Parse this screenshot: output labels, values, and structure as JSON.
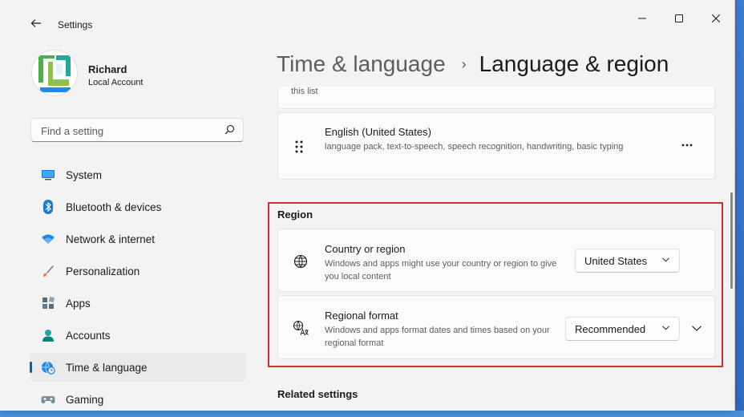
{
  "window": {
    "title": "Settings"
  },
  "profile": {
    "name": "Richard",
    "account_type": "Local Account"
  },
  "search": {
    "placeholder": "Find a setting"
  },
  "sidebar": {
    "items": [
      {
        "label": "System",
        "icon": "monitor-icon",
        "active": false
      },
      {
        "label": "Bluetooth & devices",
        "icon": "bluetooth-icon",
        "active": false
      },
      {
        "label": "Network & internet",
        "icon": "wifi-icon",
        "active": false
      },
      {
        "label": "Personalization",
        "icon": "brush-icon",
        "active": false
      },
      {
        "label": "Apps",
        "icon": "apps-icon",
        "active": false
      },
      {
        "label": "Accounts",
        "icon": "person-icon",
        "active": false
      },
      {
        "label": "Time & language",
        "icon": "globe-clock-icon",
        "active": true
      },
      {
        "label": "Gaming",
        "icon": "gamepad-icon",
        "active": false
      }
    ]
  },
  "breadcrumb": {
    "parent": "Time & language",
    "separator": "›",
    "current": "Language & region"
  },
  "languages": {
    "partial_text": "this list",
    "items": [
      {
        "name": "English (United States)",
        "features": "language pack, text-to-speech, speech recognition, handwriting, basic typing"
      }
    ]
  },
  "region": {
    "header": "Region",
    "country": {
      "title": "Country or region",
      "description": "Windows and apps might use your country or region to give you local content",
      "value": "United States"
    },
    "format": {
      "title": "Regional format",
      "description": "Windows and apps format dates and times based on your regional format",
      "value": "Recommended"
    }
  },
  "related": {
    "header": "Related settings"
  },
  "colors": {
    "accent": "#005fb8",
    "highlight_border": "#d32f2f"
  }
}
